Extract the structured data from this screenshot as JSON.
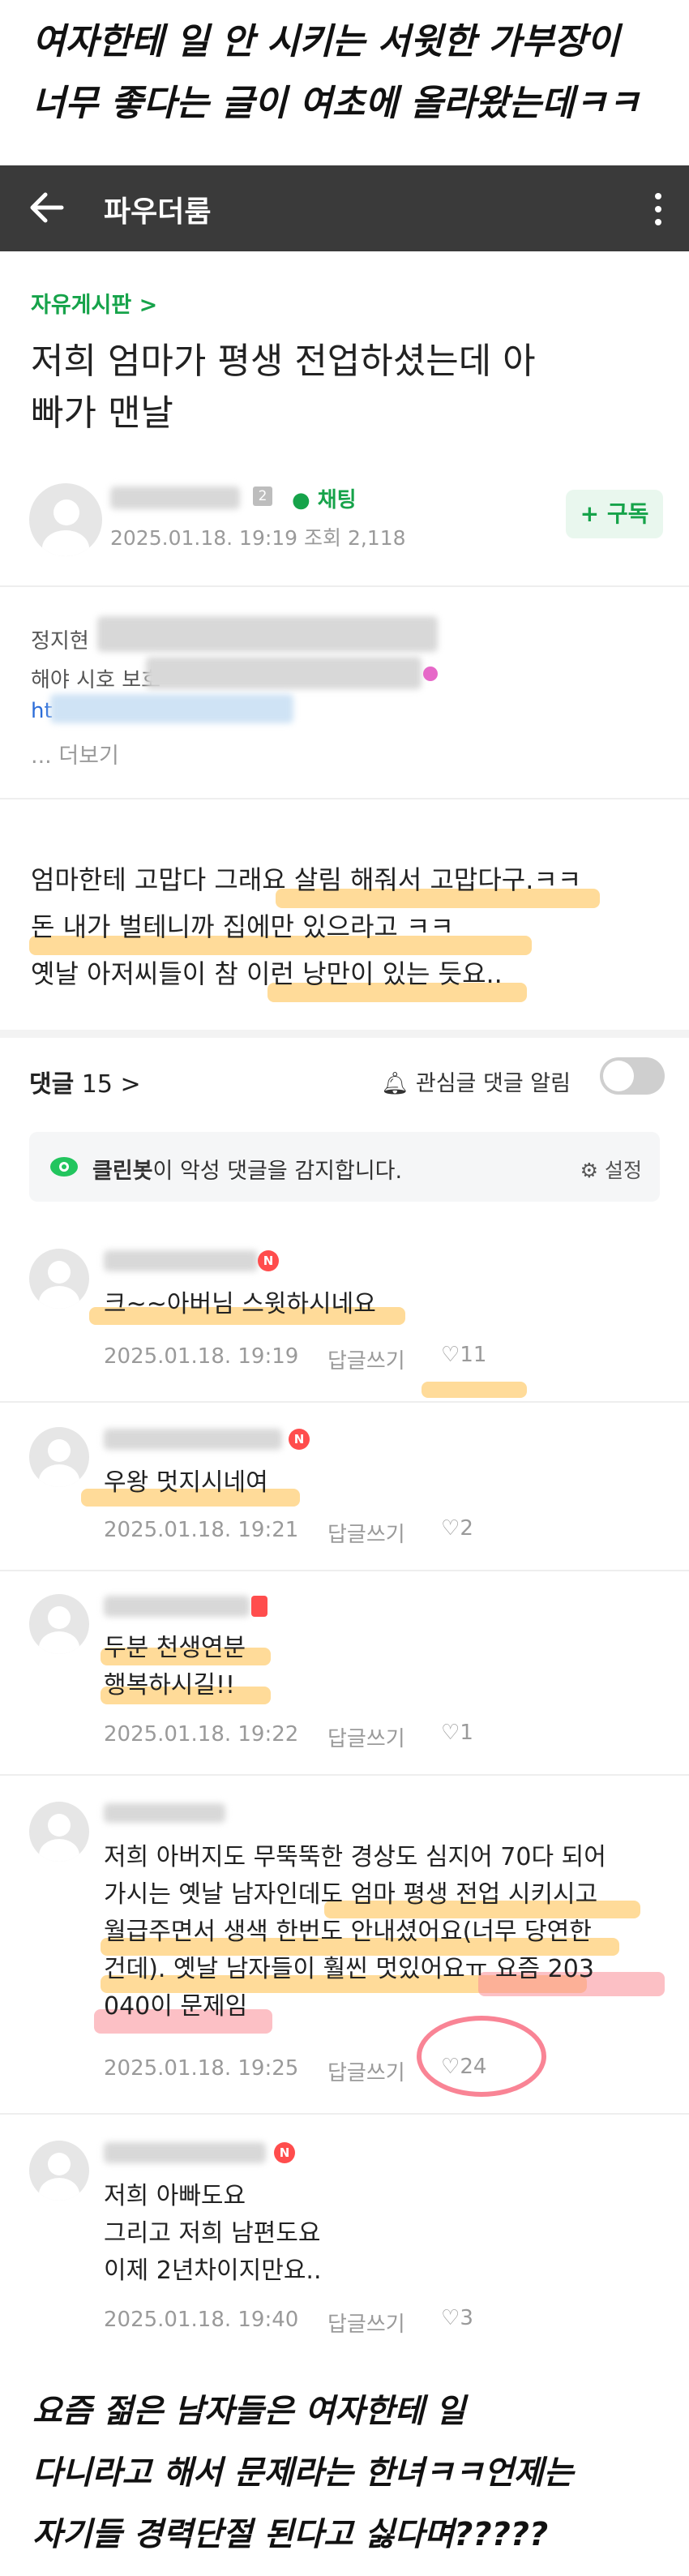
{
  "caption_top": {
    "line1": "여자한테 일 안 시키는 서윗한 가부장이",
    "line2": "너무 좋다는 글이 여초에 올라왔는데ㅋㅋ"
  },
  "appbar": {
    "title": "파우더룸"
  },
  "post": {
    "board": "자유게시판 >",
    "title_line1": "저희 엄마가 평생 전업하셨는데 아",
    "title_line2": "빠가 맨날",
    "level_badge": "2",
    "chat_label": "채팅",
    "date": "2025.01.18. 19:19",
    "views": "조회 2,118",
    "subscribe_label": "+ 구독",
    "preview_partial": "정지현",
    "preview_partial2": "해야 시호 보호",
    "preview_link": "ht",
    "more_label": "... 더보기",
    "body_line1": "엄마한테 고맙다 그래요 살림 해줘서 고맙다구.ㅋㅋ",
    "body_line2": "돈 내가 벌테니까 집에만 있으라고 ㅋㅋ",
    "body_line3": "옛날 아저씨들이 참 이런 낭만이 있는 듯요.."
  },
  "comments_header": {
    "label": "댓글",
    "count": "15",
    "chevron": ">",
    "alert_label": "관심글 댓글 알림"
  },
  "cleanbot": {
    "name": "클린봇",
    "text": "이 악성 댓글을 감지합니다.",
    "settings": "설정"
  },
  "comments": [
    {
      "lines": [
        "크~~아버님 스윗하시네요"
      ],
      "date": "2025.01.18. 19:19",
      "reply": "답글쓰기",
      "likes": "11"
    },
    {
      "lines": [
        "우왕 멋지시네여"
      ],
      "date": "2025.01.18. 19:21",
      "reply": "답글쓰기",
      "likes": "2"
    },
    {
      "lines": [
        "두분 천생연분",
        "행복하시길!!"
      ],
      "date": "2025.01.18. 19:22",
      "reply": "답글쓰기",
      "likes": "1"
    },
    {
      "lines": [
        "저희 아버지도 무뚝뚝한 경상도 심지어 70다 되어",
        "가시는 옛날 남자인데도 엄마 평생 전업 시키시고",
        "월급주면서 생색 한번도 안내셨어요(너무 당연한",
        "건데). 옛날 남자들이 훨씬 멋있어요ㅠ 요즘 203",
        "040이 문제임"
      ],
      "date": "2025.01.18. 19:25",
      "reply": "답글쓰기",
      "likes": "24"
    },
    {
      "lines": [
        "저희 아빠도요",
        "그리고 저희 남편도요",
        "이제 2년차이지만요.."
      ],
      "date": "2025.01.18. 19:40",
      "reply": "답글쓰기",
      "likes": "3"
    }
  ],
  "caption_bottom": {
    "line1": "요즘 젊은 남자들은 여자한테 일",
    "line2": "다니라고 해서 문제라는 한녀ㅋㅋ언제는",
    "line3": "자기들 경력단절 된다고 싫다며?????"
  },
  "colors": {
    "accent_green": "#16a34a",
    "appbar": "#3a3a3a",
    "highlight_orange": "#ffbe46",
    "highlight_pink": "#fa8c96"
  }
}
